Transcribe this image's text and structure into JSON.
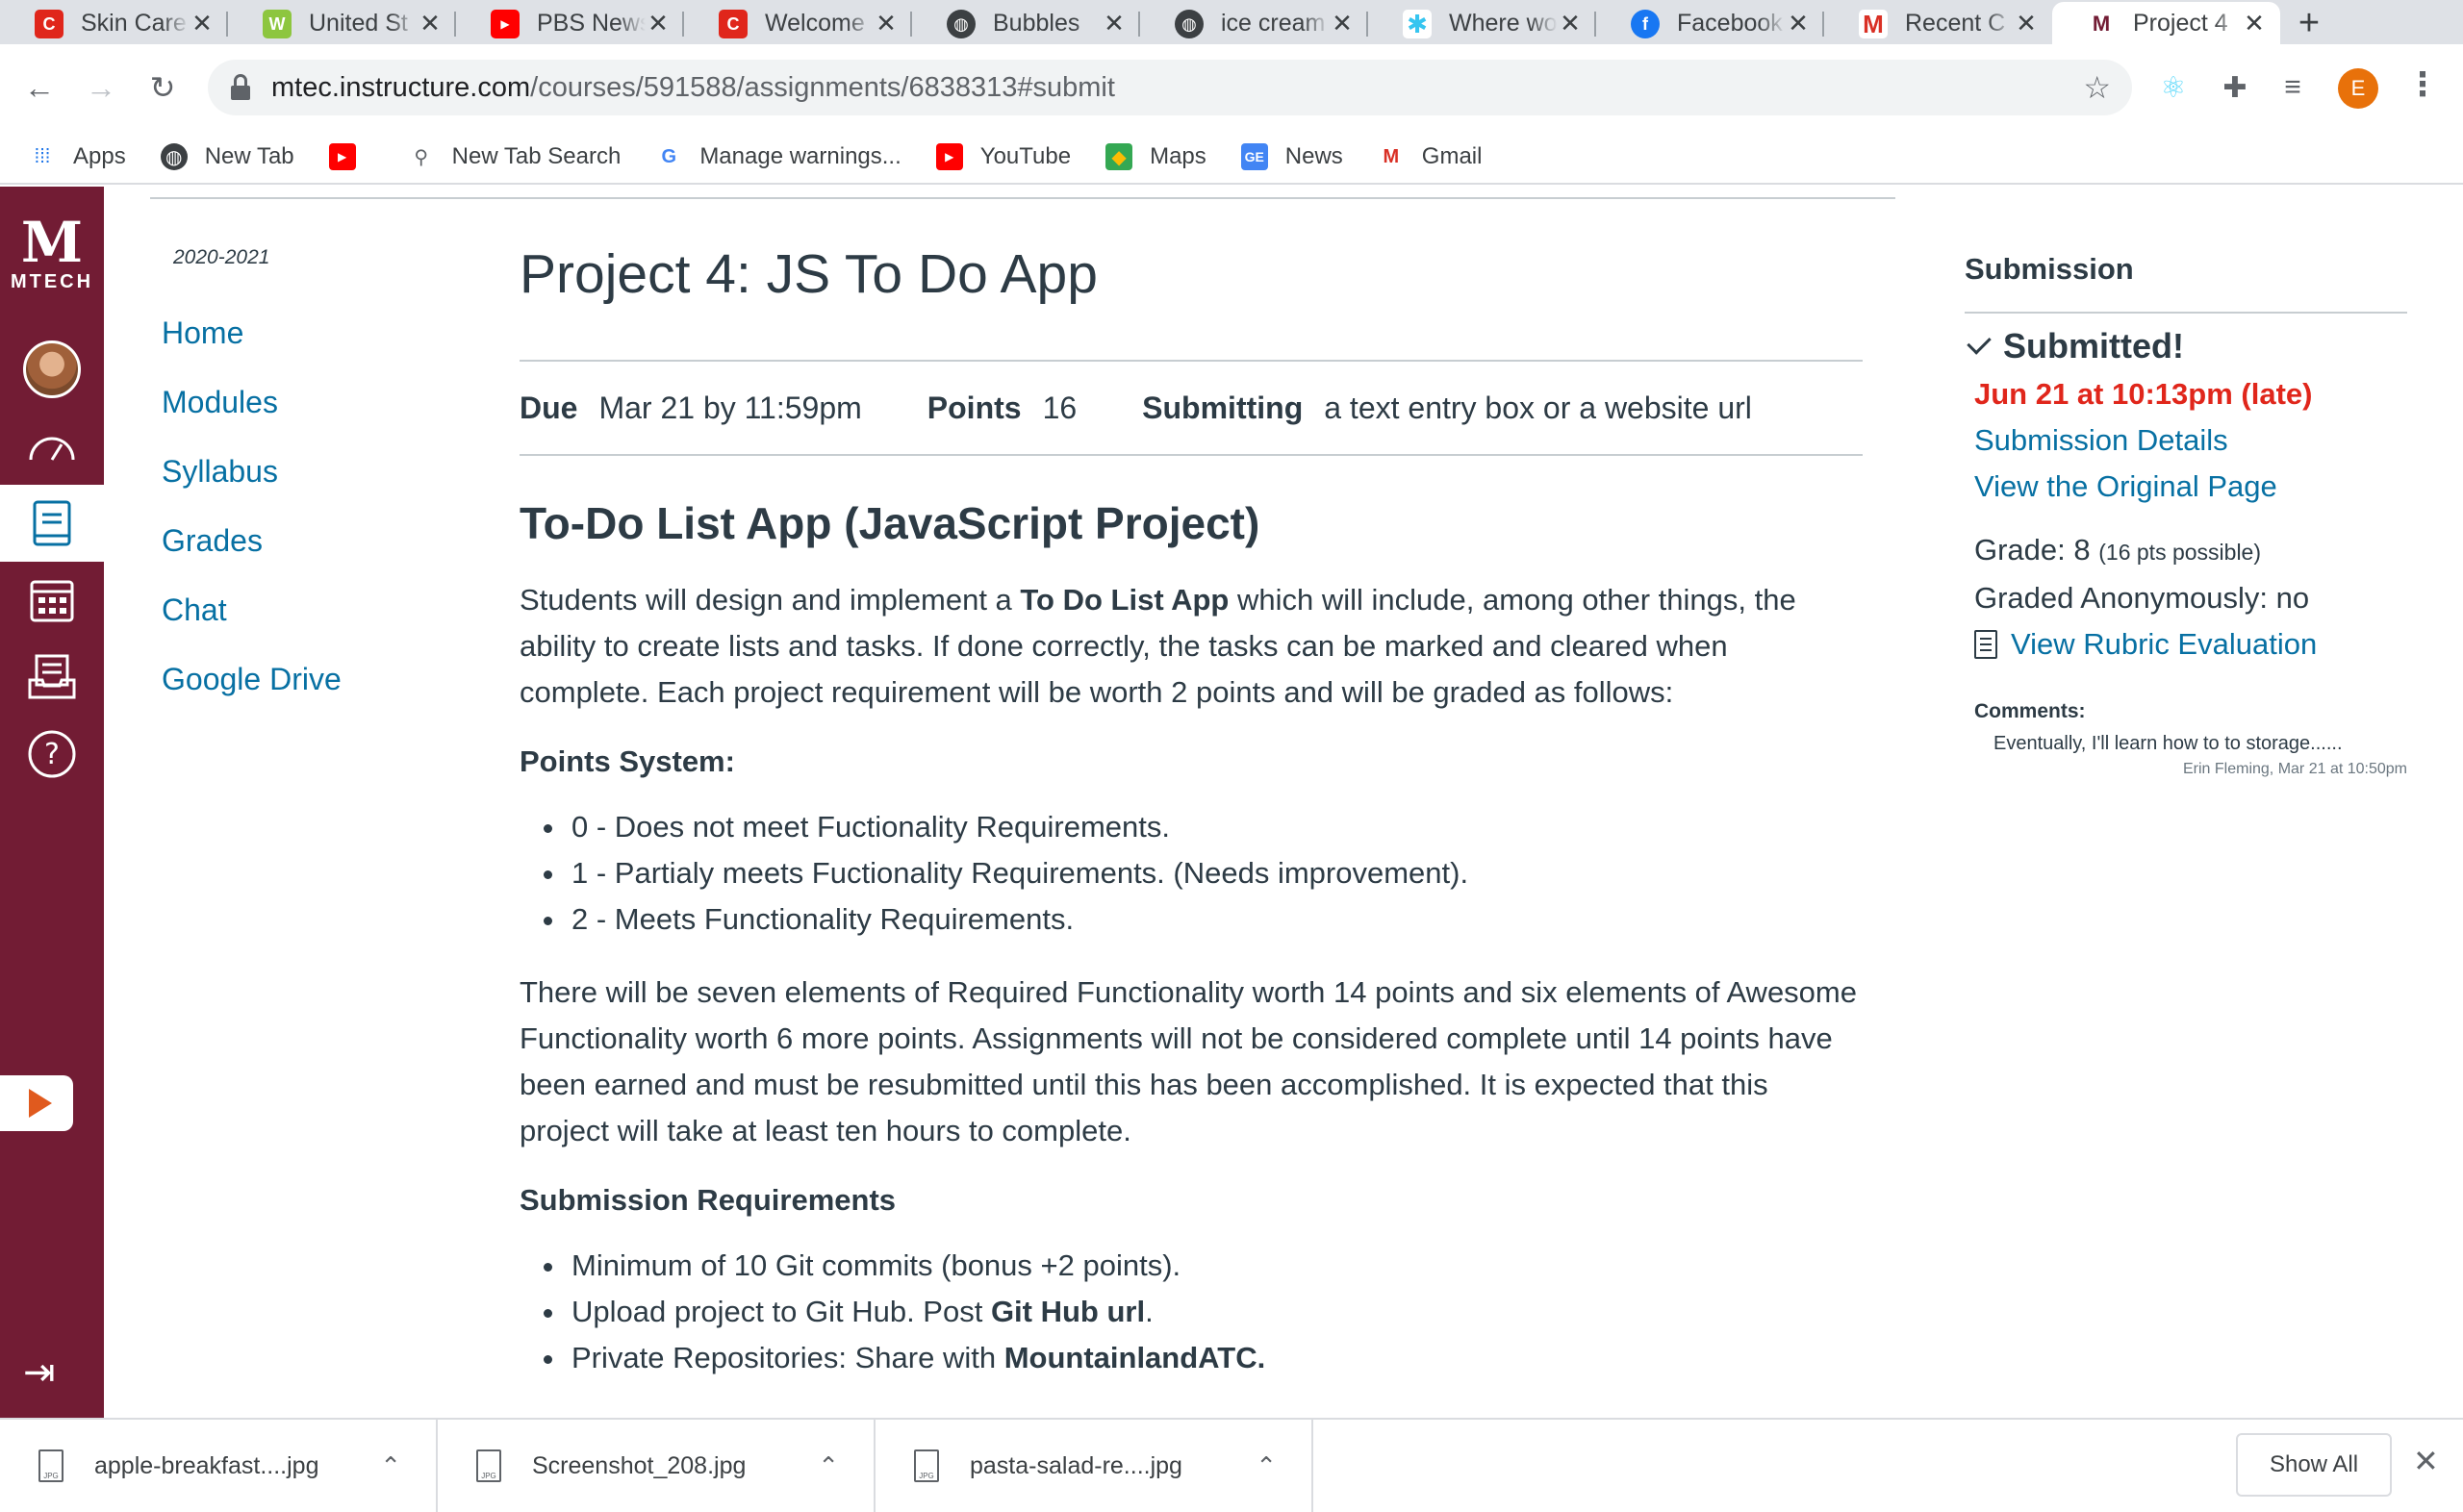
{
  "browser": {
    "tabs": [
      {
        "title": "Skin Care",
        "icon": "canvas-red-icon",
        "color": "#e0261b"
      },
      {
        "title": "United St",
        "icon": "w-green-icon",
        "color": "#8dc63f"
      },
      {
        "title": "PBS News",
        "icon": "youtube-icon",
        "color": "#ff0000"
      },
      {
        "title": "Welcome",
        "icon": "canvas-red-icon",
        "color": "#e0261b"
      },
      {
        "title": "Bubbles",
        "icon": "globe-icon",
        "color": "#3c4043"
      },
      {
        "title": "ice cream",
        "icon": "globe-icon",
        "color": "#3c4043"
      },
      {
        "title": "Where wo",
        "icon": "slack-icon",
        "color": "#4a154b"
      },
      {
        "title": "Facebook",
        "icon": "facebook-icon",
        "color": "#1877f2"
      },
      {
        "title": "Recent C",
        "icon": "gmail-icon",
        "color": "#d93025"
      },
      {
        "title": "Project 4",
        "icon": "mtech-icon",
        "color": "#721c34"
      }
    ],
    "url_domain": "mtec.instructure.com",
    "url_path": "/courses/591588/assignments/6838313#submit",
    "profile_initial": "E",
    "bookmarks": [
      {
        "label": "Apps",
        "icon": "apps-grid-icon"
      },
      {
        "label": "New Tab",
        "icon": "globe-icon"
      },
      {
        "label": "",
        "icon": "youtube-icon"
      },
      {
        "label": "New Tab Search",
        "icon": "search-icon"
      },
      {
        "label": "Manage warnings...",
        "icon": "google-icon"
      },
      {
        "label": "YouTube",
        "icon": "youtube-icon"
      },
      {
        "label": "Maps",
        "icon": "maps-icon"
      },
      {
        "label": "News",
        "icon": "news-icon"
      },
      {
        "label": "Gmail",
        "icon": "gmail-icon"
      }
    ]
  },
  "global_nav": {
    "logo_mark": "M",
    "logo_word": "MTECH"
  },
  "course_nav": {
    "term": "2020-2021",
    "items": [
      "Home",
      "Modules",
      "Syllabus",
      "Grades",
      "Chat",
      "Google Drive"
    ]
  },
  "assignment": {
    "title": "Project 4: JS To Do App",
    "due_label": "Due",
    "due_value": "Mar 21 by 11:59pm",
    "points_label": "Points",
    "points_value": "16",
    "submitting_label": "Submitting",
    "submitting_value": "a text entry box or a website url",
    "heading": "To-Do List App (JavaScript Project)",
    "intro_pre": "Students will design and implement a ",
    "intro_bold": "To Do List App",
    "intro_post": " which will include, among other things, the ability to create lists and tasks. If done correctly, the tasks can be marked and cleared when complete.  Each project requirement will be worth 2 points and will be graded as follows:",
    "points_system_heading": "Points System:",
    "points_system": [
      "0 - Does not meet Fuctionality Requirements.",
      "1 - Partialy meets Fuctionality Requirements. (Needs improvement).",
      "2 - Meets Functionality Requirements."
    ],
    "elements_paragraph": "There will be seven elements of Required Functionality worth 14 points and six elements of Awesome Functionality worth 6 more points. Assignments will not be considered complete until 14 points have been earned and must be resubmitted until this has been accomplished. It is expected that this project will take at least ten hours to complete.",
    "submission_heading": "Submission Requirements",
    "req1": "Minimum of 10 Git commits (bonus +2 points).",
    "req2_pre": "Upload project to Git Hub. Post ",
    "req2_bold": "Git Hub url",
    "req2_post": ".",
    "req3_pre": "Private Repositories: Share with ",
    "req3_bold": "MountainlandATC."
  },
  "submission": {
    "heading": "Submission",
    "status": "Submitted!",
    "submitted_at": "Jun 21 at 10:13pm (late)",
    "details_link": "Submission Details",
    "original_link": "View the Original Page",
    "grade_label": "Grade: 8",
    "grade_possible": "(16 pts possible)",
    "anonymous": "Graded Anonymously: no",
    "rubric_link": "View Rubric Evaluation",
    "comments_label": "Comments:",
    "comment_text": "Eventually, I'll learn how to to storage......",
    "comment_meta": "Erin Fleming, Mar 21 at 10:50pm"
  },
  "downloads": {
    "files": [
      "apple-breakfast....jpg",
      "Screenshot_208.jpg",
      "pasta-salad-re....jpg"
    ],
    "show_all": "Show All"
  }
}
